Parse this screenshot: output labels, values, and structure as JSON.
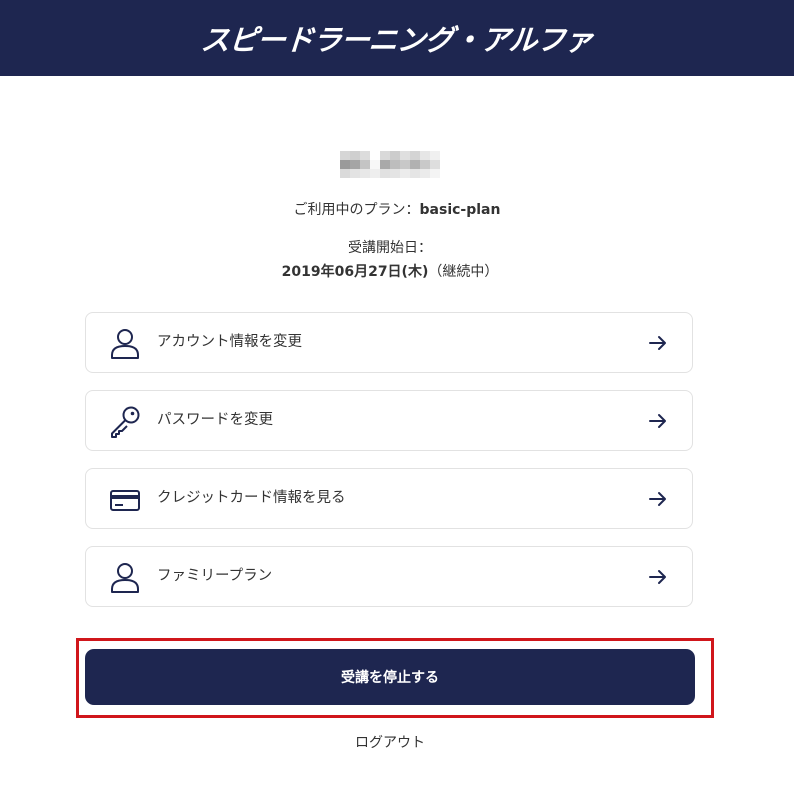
{
  "header": {
    "title": "スピードラーニング・アルファ"
  },
  "user": {
    "plan_label": "ご利用中のプラン：",
    "plan_value": "basic-plan",
    "start_label": "受講開始日：",
    "start_date": "2019年06月27日(木)",
    "start_status": "（継続中）"
  },
  "menu": {
    "items": [
      {
        "label": "アカウント情報を変更",
        "icon": "user-icon"
      },
      {
        "label": "パスワードを変更",
        "icon": "key-icon"
      },
      {
        "label": "クレジットカード情報を見る",
        "icon": "credit-card-icon"
      },
      {
        "label": "ファミリープラン",
        "icon": "user-icon"
      }
    ]
  },
  "actions": {
    "stop_label": "受講を停止する",
    "logout_label": "ログアウト"
  },
  "colors": {
    "brand_navy": "#1e2650",
    "highlight_red": "#d0161b",
    "card_border": "#e2e2e2"
  }
}
